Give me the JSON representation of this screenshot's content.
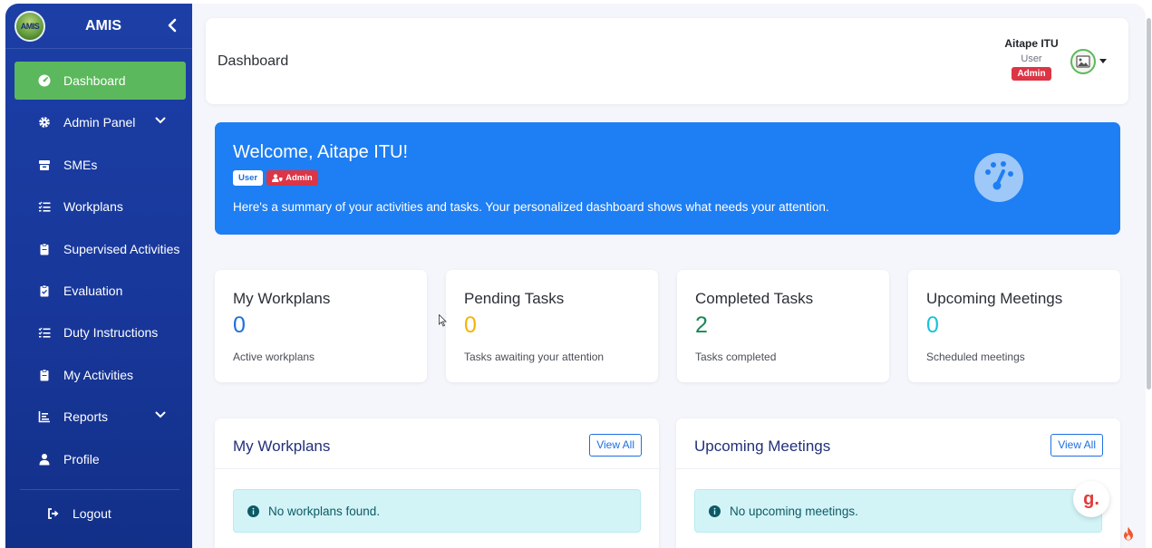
{
  "brand": {
    "logo_text": "AMIS",
    "name": "AMIS"
  },
  "sidebar": {
    "items": [
      {
        "label": "Dashboard",
        "icon": "gauge-icon",
        "active": true
      },
      {
        "label": "Admin Panel",
        "icon": "gear-icon",
        "has_submenu": true
      },
      {
        "label": "SMEs",
        "icon": "box-icon"
      },
      {
        "label": "Workplans",
        "icon": "list-check-icon"
      },
      {
        "label": "Supervised Activities",
        "icon": "clipboard-icon"
      },
      {
        "label": "Evaluation",
        "icon": "clipboard-check-icon"
      },
      {
        "label": "Duty Instructions",
        "icon": "list-check-icon"
      },
      {
        "label": "My Activities",
        "icon": "clipboard-icon"
      },
      {
        "label": "Reports",
        "icon": "chart-icon",
        "has_submenu": true
      },
      {
        "label": "Profile",
        "icon": "user-icon"
      }
    ],
    "logout_label": "Logout"
  },
  "topbar": {
    "title": "Dashboard",
    "user_name": "Aitape ITU",
    "user_role": "User",
    "admin_badge": "Admin"
  },
  "welcome": {
    "title": "Welcome, Aitape ITU!",
    "badge_user": "User",
    "badge_admin": "Admin",
    "message": "Here's a summary of your activities and tasks. Your personalized dashboard shows what needs your attention."
  },
  "stats": [
    {
      "title": "My Workplans",
      "value": "0",
      "subtitle": "Active workplans",
      "color": "#1e6fe0"
    },
    {
      "title": "Pending Tasks",
      "value": "0",
      "subtitle": "Tasks awaiting your attention",
      "color": "#f5b400"
    },
    {
      "title": "Completed Tasks",
      "value": "2",
      "subtitle": "Tasks completed",
      "color": "#198754"
    },
    {
      "title": "Upcoming Meetings",
      "value": "0",
      "subtitle": "Scheduled meetings",
      "color": "#17c3d8"
    }
  ],
  "panels": [
    {
      "title": "My Workplans",
      "button": "View All",
      "empty_message": "No workplans found."
    },
    {
      "title": "Upcoming Meetings",
      "button": "View All",
      "empty_message": "No upcoming meetings."
    }
  ],
  "floating": {
    "g_label": "g."
  },
  "colors": {
    "sidebar": "#1c3fa6",
    "active": "#5cb85c",
    "primary": "#1e7ef3",
    "danger": "#dc3545"
  }
}
